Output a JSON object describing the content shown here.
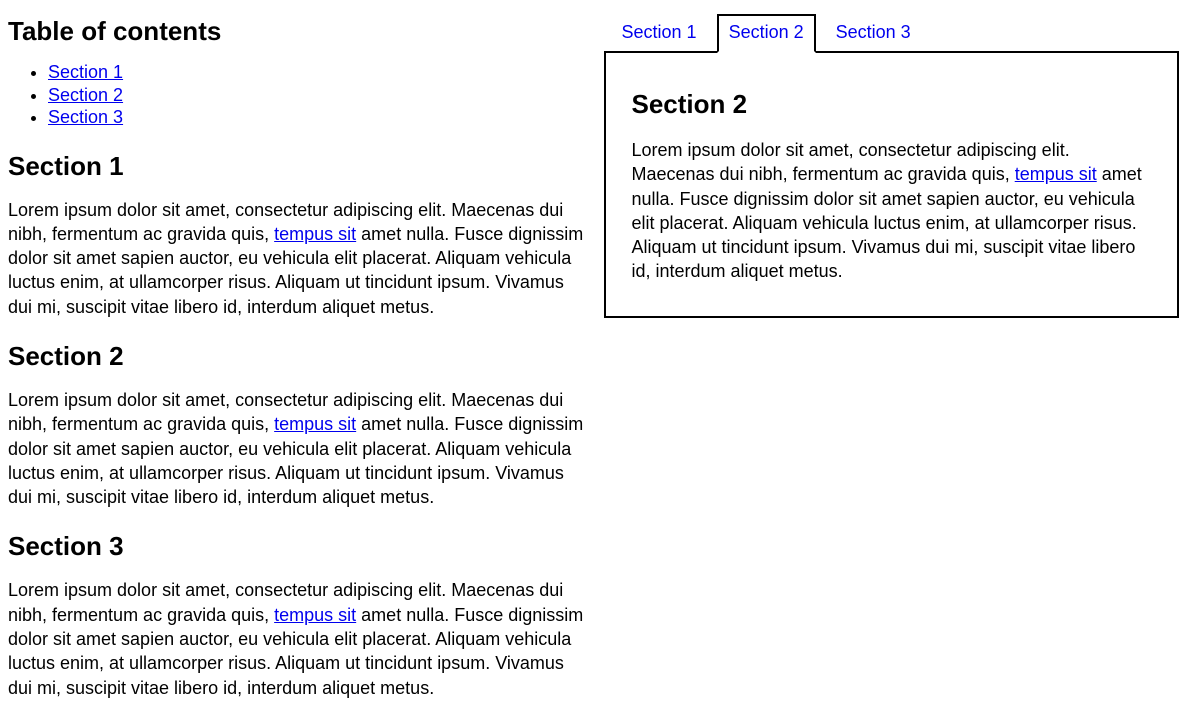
{
  "toc": {
    "title": "Table of contents",
    "items": [
      {
        "label": "Section 1"
      },
      {
        "label": "Section 2"
      },
      {
        "label": "Section 3"
      }
    ]
  },
  "sections": [
    {
      "heading": "Section 1",
      "para_pre": "Lorem ipsum dolor sit amet, consectetur adipiscing elit. Maecenas dui nibh, fermentum ac gravida quis, ",
      "link_text": "tempus sit",
      "para_post": " amet nulla. Fusce dignissim dolor sit amet sapien auctor, eu vehicula elit placerat. Aliquam vehicula luctus enim, at ullamcorper risus. Aliquam ut tincidunt ipsum. Vivamus dui mi, suscipit vitae libero id, interdum aliquet metus."
    },
    {
      "heading": "Section 2",
      "para_pre": "Lorem ipsum dolor sit amet, consectetur adipiscing elit. Maecenas dui nibh, fermentum ac gravida quis, ",
      "link_text": "tempus sit",
      "para_post": " amet nulla. Fusce dignissim dolor sit amet sapien auctor, eu vehicula elit placerat. Aliquam vehicula luctus enim, at ullamcorper risus. Aliquam ut tincidunt ipsum. Vivamus dui mi, suscipit vitae libero id, interdum aliquet metus."
    },
    {
      "heading": "Section 3",
      "para_pre": "Lorem ipsum dolor sit amet, consectetur adipiscing elit. Maecenas dui nibh, fermentum ac gravida quis, ",
      "link_text": "tempus sit",
      "para_post": " amet nulla. Fusce dignissim dolor sit amet sapien auctor, eu vehicula elit placerat. Aliquam vehicula luctus enim, at ullamcorper risus. Aliquam ut tincidunt ipsum. Vivamus dui mi, suscipit vitae libero id, interdum aliquet metus."
    }
  ],
  "tabs": {
    "items": [
      {
        "label": "Section 1"
      },
      {
        "label": "Section 2"
      },
      {
        "label": "Section 3"
      }
    ],
    "active_index": 1,
    "panel": {
      "heading": "Section 2",
      "para_pre": "Lorem ipsum dolor sit amet, consectetur adipiscing elit. Maecenas dui nibh, fermentum ac gravida quis, ",
      "link_text": "tempus sit",
      "para_post": " amet nulla. Fusce dignissim dolor sit amet sapien auctor, eu vehicula elit placerat. Aliquam vehicula luctus enim, at ullamcorper risus. Aliquam ut tincidunt ipsum. Vivamus dui mi, suscipit vitae libero id, interdum aliquet metus."
    }
  }
}
